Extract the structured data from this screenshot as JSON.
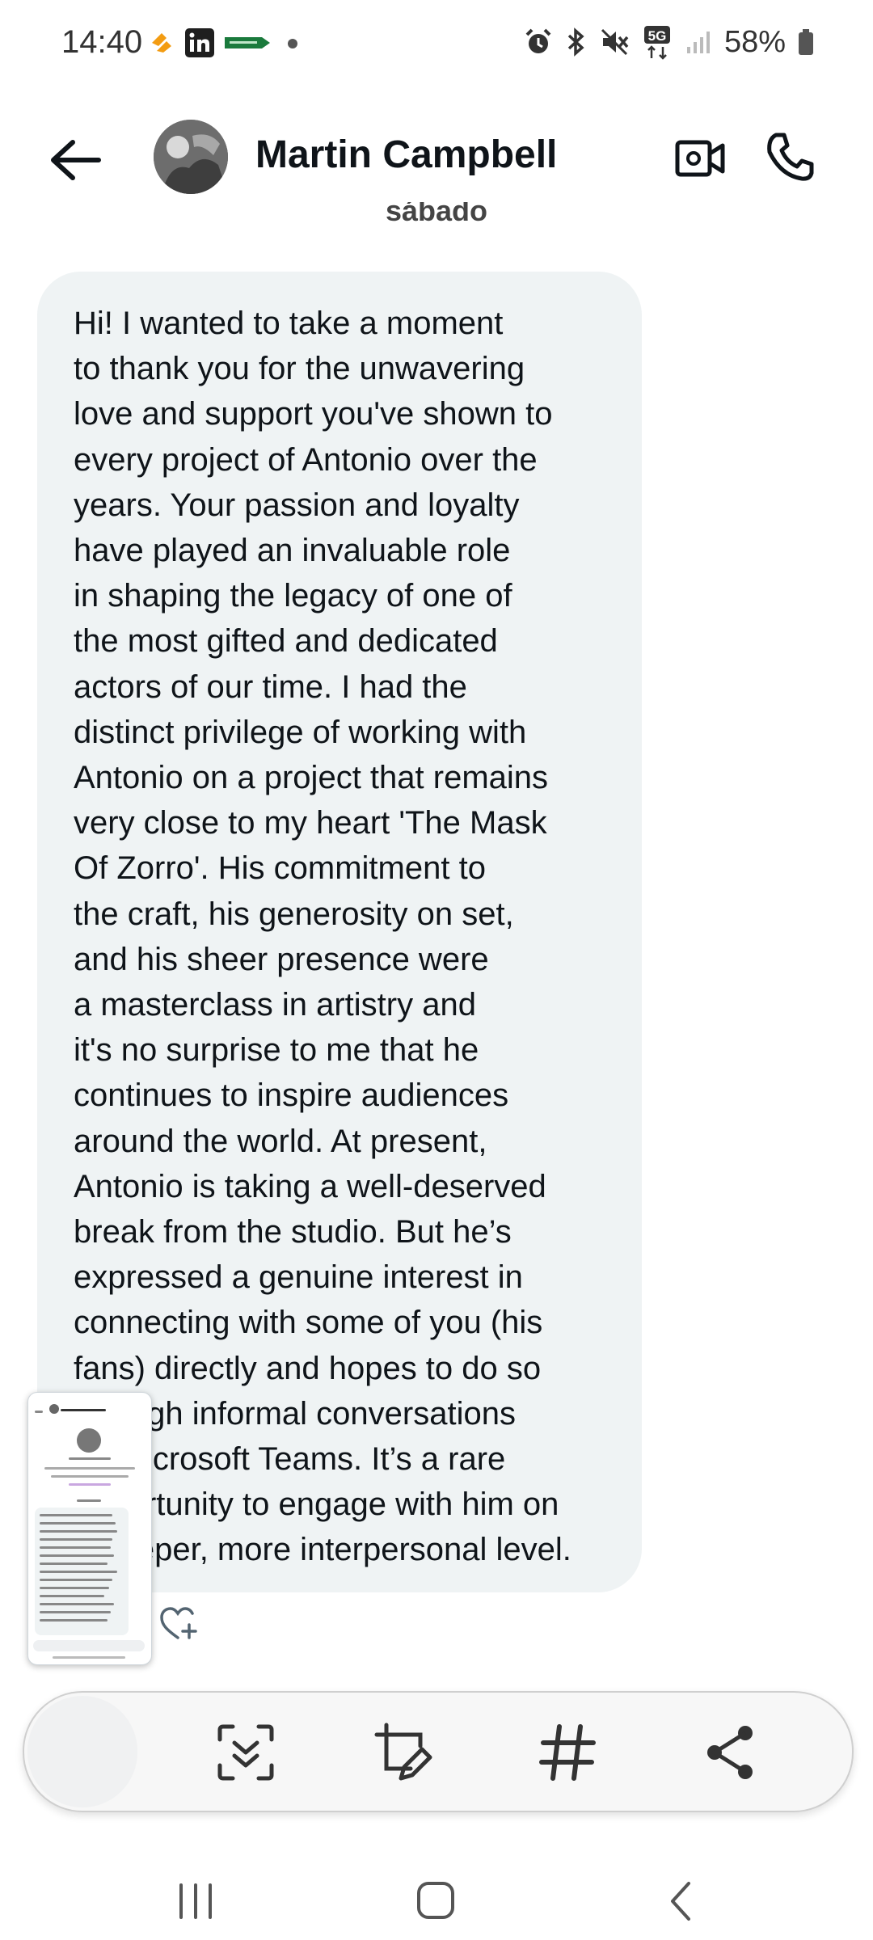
{
  "status_bar": {
    "time": "14:40",
    "network": "5G",
    "battery": "58%",
    "left_icons": [
      "pay-app-icon",
      "linkedin-icon",
      "store-app-icon",
      "dot-icon"
    ],
    "right_icons": [
      "alarm-icon",
      "bluetooth-icon",
      "mute-icon",
      "5g-icon",
      "signal-icon",
      "battery-icon"
    ]
  },
  "header": {
    "contact_name": "Martin Campbell"
  },
  "conversation": {
    "date_separator": "sábado",
    "message": "Hi! I wanted to take a moment\nto thank you for the unwavering\nlove and support you've shown to\nevery project of Antonio over the\nyears. Your passion and loyalty\nhave played an invaluable role\nin shaping the legacy of one of\nthe most gifted and dedicated\nactors of our time. I had the\ndistinct privilege of working with\nAntonio on a project that remains\nvery close to my heart 'The Mask\nOf Zorro'. His commitment to\nthe craft, his generosity on set,\nand his sheer presence were\na masterclass in artistry and\nit's no surprise to me that he\ncontinues to inspire audiences\naround the world. At present,\nAntonio is taking a well-deserved\nbreak from the studio. But he’s\nexpressed a genuine interest in\nconnecting with some of you (his\nfans) directly and hopes to do so\nthrough informal conversations\non Microsoft Teams. It’s a rare\nopportunity to engage with him on\na deeper, more interpersonal level."
  },
  "screenshot_toolbar": {
    "actions": [
      "scroll-capture-icon",
      "crop-edit-icon",
      "hashtag-icon",
      "share-icon"
    ]
  },
  "nav_bar": {
    "buttons": [
      "recent-apps",
      "home",
      "back"
    ]
  },
  "colors": {
    "bubble": "#eff3f4",
    "text": "#0f1419",
    "icon": "#222222"
  }
}
